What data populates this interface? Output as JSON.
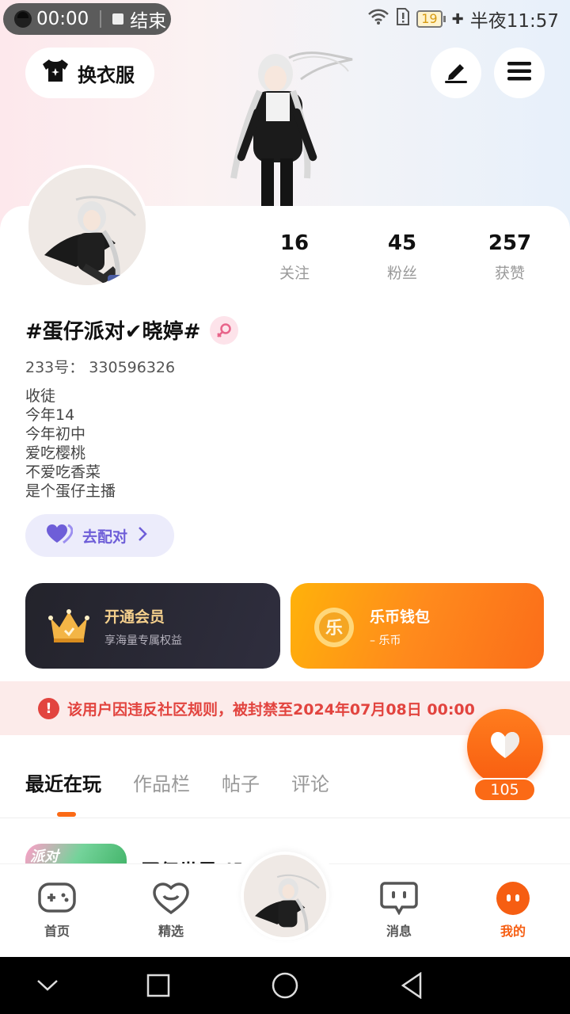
{
  "status_bar": {
    "record_time": "00:00",
    "end_label": "结束",
    "battery": "19",
    "time": "半夜11:57"
  },
  "header": {
    "wardrobe_label": "换衣服"
  },
  "profile": {
    "stats": [
      {
        "value": "16",
        "label": "关注"
      },
      {
        "value": "45",
        "label": "粉丝"
      },
      {
        "value": "257",
        "label": "获赞"
      }
    ],
    "nickname": "#蛋仔派对✔晓婷#",
    "uid": "233号：  330596326",
    "bio": [
      "收徒",
      "今年14",
      "今年初中",
      "爱吃樱桃",
      "不爱吃香菜",
      "是个蛋仔主播"
    ],
    "match_label": "去配对"
  },
  "promos": {
    "vip": {
      "title": "开通会员",
      "subtitle": "享海量专属权益"
    },
    "wallet": {
      "title": "乐币钱包",
      "subtitle": "– 乐币",
      "coin_char": "乐"
    }
  },
  "ban_notice": {
    "text": "该用户因违反社区规则，被封禁至2024年07月08日 00:00"
  },
  "likes": {
    "count": "105"
  },
  "tabs": [
    "最近在玩",
    "作品栏",
    "帖子",
    "评论"
  ],
  "recent": {
    "thumb_text": "派对",
    "title": "蛋仔世界 (元"
  },
  "bottom_nav": [
    {
      "label": "首页",
      "icon": "gamepad-icon"
    },
    {
      "label": "精选",
      "icon": "heart-chat-icon"
    },
    {
      "label": "消息",
      "icon": "message-icon"
    },
    {
      "label": "我的",
      "icon": "profile-face-icon"
    }
  ],
  "colors": {
    "accent": "#fb6a16",
    "ban_red": "#e2443f",
    "match_purple": "#6e5ed8",
    "vip_gold": "#f4cf8c"
  }
}
